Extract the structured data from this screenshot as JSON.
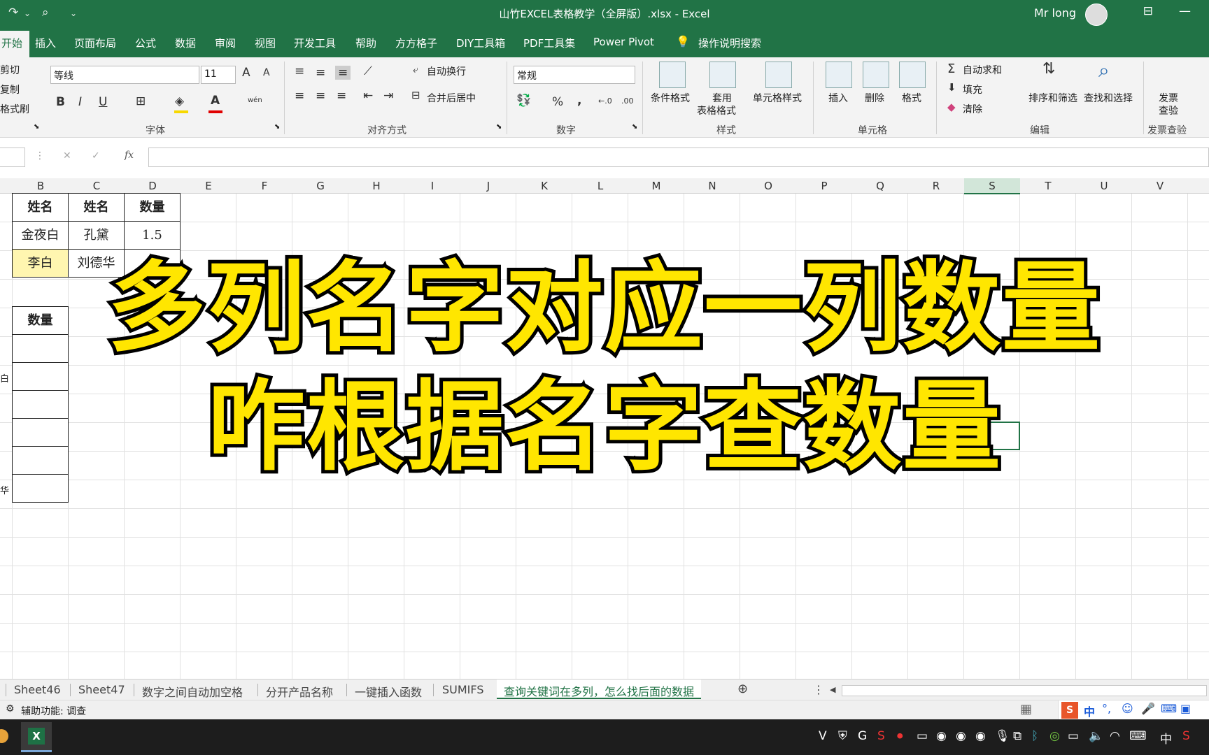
{
  "titlebar": {
    "title": "山竹EXCEL表格教学（全屏版）.xlsx  -  Excel",
    "user": "Mr long",
    "icons": [
      "redo-icon",
      "print-preview-icon",
      "customize-icon",
      "ribbon-display-icon",
      "minimize-icon"
    ]
  },
  "ribbon_tabs": [
    "开始",
    "插入",
    "页面布局",
    "公式",
    "数据",
    "审阅",
    "视图",
    "开发工具",
    "帮助",
    "方方格子",
    "DIY工具箱",
    "PDF工具集",
    "Power Pivot",
    "操作说明搜索"
  ],
  "clipboard": {
    "cut": "剪切",
    "copy": "复制",
    "format_painter": "格式刷"
  },
  "font": {
    "name": "等线",
    "size": "11",
    "group_label": "字体",
    "bold": "B",
    "italic": "I",
    "underline": "U",
    "grow": "A",
    "shrink": "A",
    "wen": "wén",
    "fill_color": "#f7d800",
    "font_color": "#e00000"
  },
  "alignment": {
    "wrap": "自动换行",
    "merge": "合并后居中",
    "group_label": "对齐方式"
  },
  "number": {
    "format": "常规",
    "percent": "%",
    "comma": ",",
    "inc_decimal": "←.0",
    "dec_decimal": ".00",
    "group_label": "数字"
  },
  "styles": {
    "conditional": "条件格式",
    "table_fmt_1": "套用",
    "table_fmt_2": "表格格式",
    "cell_styles": "单元格样式",
    "group_label": "样式"
  },
  "cells": {
    "insert": "插入",
    "delete": "删除",
    "format": "格式",
    "group_label": "单元格"
  },
  "editing": {
    "autosum": "自动求和",
    "fill": "填充",
    "clear": "清除",
    "sort": "排序和筛选",
    "find": "查找和选择",
    "group_label": "编辑"
  },
  "invoice": {
    "line1": "发票",
    "line2": "查验",
    "group_label": "发票查验"
  },
  "formula_bar": {
    "fx": "fx",
    "cancel": "✕",
    "enter": "✓"
  },
  "columns": [
    "B",
    "C",
    "D",
    "E",
    "F",
    "G",
    "H",
    "I",
    "J",
    "K",
    "L",
    "M",
    "N",
    "O",
    "P",
    "Q",
    "R",
    "S",
    "T",
    "U",
    "V"
  ],
  "selected_column": "S",
  "table1": {
    "headers": [
      "姓名",
      "姓名",
      "数量"
    ],
    "rows": [
      [
        "金夜白",
        "孔黛",
        "1.5"
      ],
      [
        "李白",
        "刘德华",
        ""
      ]
    ]
  },
  "table2": {
    "header": "数量",
    "left_fragments": [
      "白",
      "华"
    ]
  },
  "overlay": {
    "line1": "多列名字对应一列数量",
    "line2": "咋根据名字查数量"
  },
  "sheets": [
    "Sheet46",
    "Sheet47",
    "数字之间自动加空格",
    "分开产品名称",
    "一键插入函数",
    "SUMIFS",
    "查询关键词在多列，怎么找后面的数据"
  ],
  "active_sheet_index": 6,
  "status": {
    "accessibility": "辅助功能: 调查"
  },
  "taskbar": {
    "app": "X",
    "ime": "中"
  }
}
